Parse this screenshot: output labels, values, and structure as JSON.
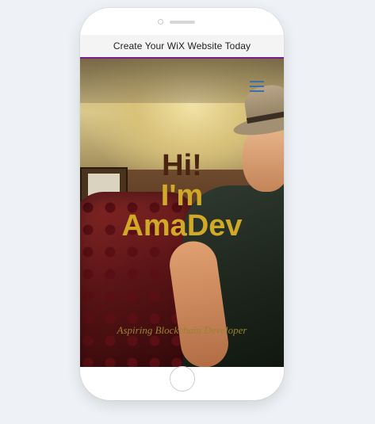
{
  "banner": {
    "text": "Create Your WiX Website Today",
    "accent_color": "#7a1f8a"
  },
  "hero": {
    "line1": "Hi!",
    "line2": "I'm",
    "line3": "AmaDev",
    "subtitle": "Aspiring Blockchain Developer",
    "line1_color": "#4a2410",
    "name_color": "#d1a926"
  },
  "icons": {
    "menu": "hamburger-menu-icon",
    "home": "home-button"
  }
}
